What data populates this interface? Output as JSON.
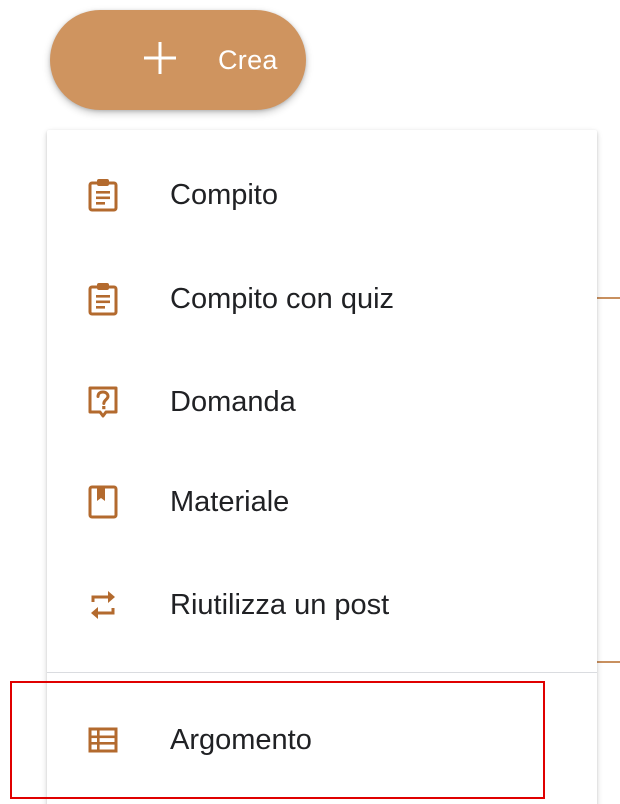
{
  "create_button": {
    "label": "Crea",
    "icon": "plus-icon"
  },
  "menu": {
    "items": [
      {
        "label": "Compito",
        "icon": "assignment-icon"
      },
      {
        "label": "Compito con quiz",
        "icon": "quiz-assignment-icon"
      },
      {
        "label": "Domanda",
        "icon": "question-icon"
      },
      {
        "label": "Materiale",
        "icon": "material-icon"
      },
      {
        "label": "Riutilizza un post",
        "icon": "reuse-icon"
      },
      {
        "label": "Argomento",
        "icon": "topic-icon"
      }
    ]
  },
  "colors": {
    "accent": "#cf945f",
    "icon": "#b36a2e",
    "text": "#202124",
    "highlight": "#e00000"
  }
}
